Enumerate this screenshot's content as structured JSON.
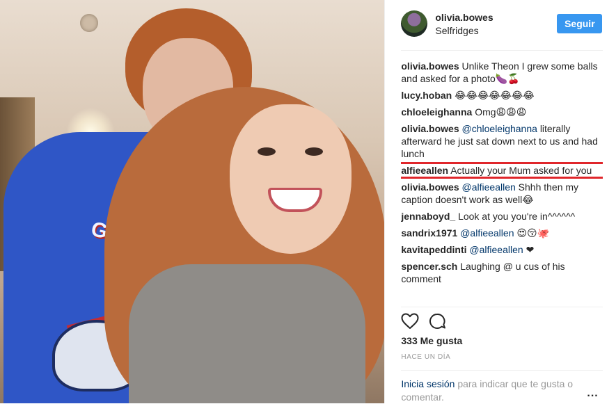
{
  "post": {
    "author": "olivia.bowes",
    "location": "Selfridges",
    "follow_label": "Seguir",
    "photo_print": "GIANTS"
  },
  "comments": [
    {
      "user": "olivia.bowes",
      "text": "Unlike Theon I grew some balls and asked for a photo🍆🍒"
    },
    {
      "user": "lucy.hoban",
      "text": "😂😂😂😂😂😂😂"
    },
    {
      "user": "chloeleighanna",
      "text": "Omg😩😩😩"
    },
    {
      "user": "olivia.bowes",
      "mention": "@chloeleighanna",
      "text": "literally afterward he just sat down next to us and had lunch"
    },
    {
      "user": "alfieeallen",
      "text": "Actually your Mum asked for you",
      "highlighted": true
    },
    {
      "user": "olivia.bowes",
      "mention": "@alfieeallen",
      "text": "Shhh then my caption doesn't work as well😂"
    },
    {
      "user": "jennaboyd_",
      "text": "Look at you you're in^^^^^^"
    },
    {
      "user": "sandrix1971",
      "mention": "@alfieeallen",
      "text": "😍😚🐙"
    },
    {
      "user": "kavitapeddinti",
      "mention": "@alfieeallen",
      "text": "❤"
    },
    {
      "user": "spencer.sch",
      "text": "Laughing @ u cus of his comment"
    }
  ],
  "actions": {
    "like_icon": "heart-icon",
    "comment_icon": "speech-bubble-icon"
  },
  "likes": "333 Me gusta",
  "timestamp": "HACE UN DÍA",
  "footer": {
    "login_link": "Inicia sesión",
    "login_text": "para indicar que te gusta o comentar.",
    "more_label": "..."
  },
  "colors": {
    "follow_button": "#3897f0",
    "highlight_border": "#e0262b",
    "link": "#003569"
  }
}
